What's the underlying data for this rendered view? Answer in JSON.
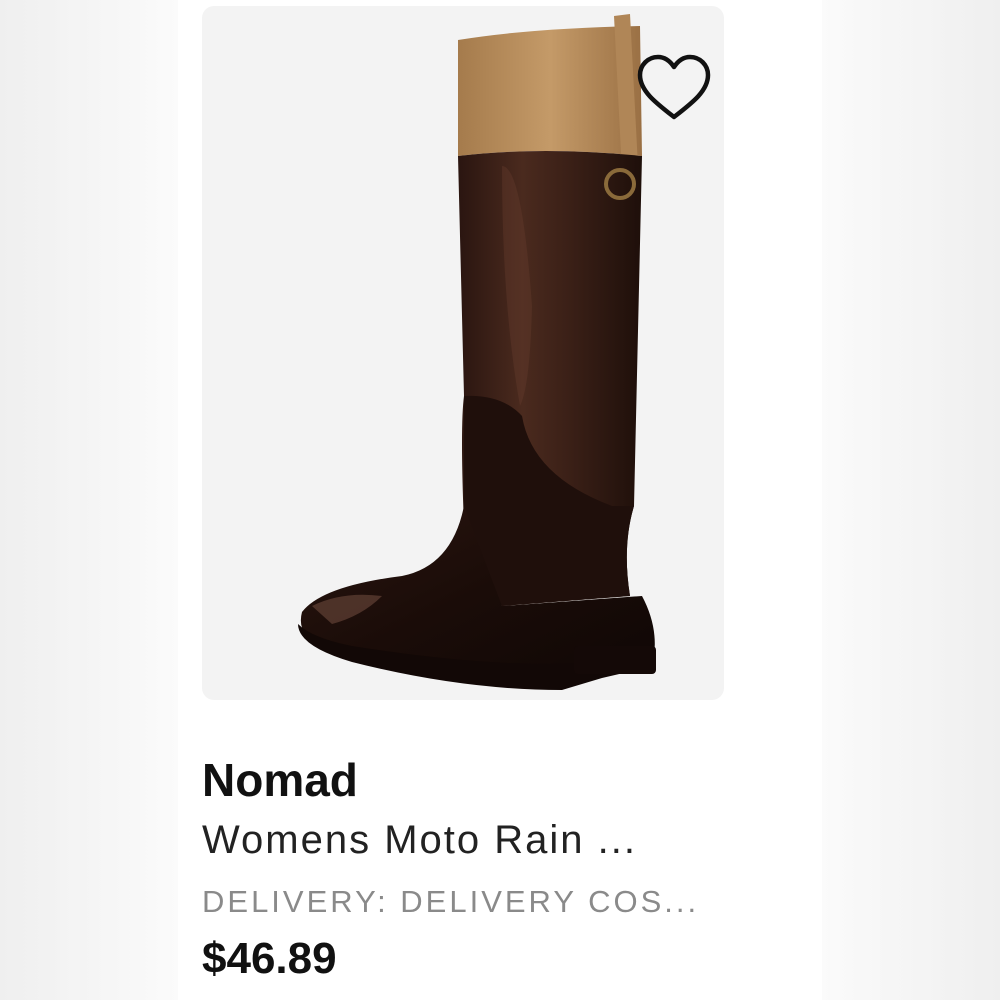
{
  "product": {
    "brand": "Nomad",
    "title": "Womens Moto Rain ...",
    "delivery": "DELIVERY: DELIVERY COS...",
    "price": "$46.89",
    "image_alt": "Womens Moto Rain boot, brown with tan cuff",
    "favorite_icon": "heart-outline-icon"
  },
  "colors": {
    "card_background": "#ffffff",
    "image_background": "#f3f3f3",
    "boot_tan": "#b48a5a",
    "boot_brown": "#3a2118",
    "boot_dark": "#1c0f0b"
  }
}
